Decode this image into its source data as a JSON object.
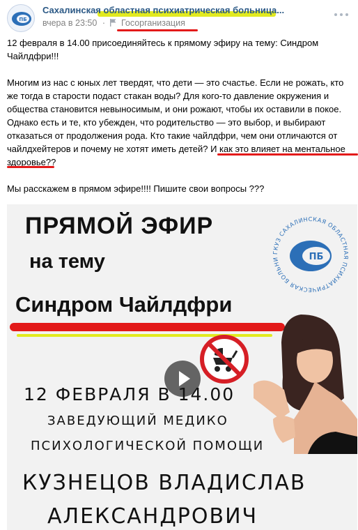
{
  "post": {
    "org_name": "Сахалинская областная психиатрическая больница",
    "org_name_display": "Сахалинская областная психиатрическая больница...",
    "time": "вчера в 23:50",
    "separator": "·",
    "category": "Госорганизация",
    "paragraphs": [
      "12 февраля в 14.00 присоединяйтесь к прямому эфиру на тему: Синдром Чайлдфри!!!",
      "Многим из нас с юных лет твердят, что дети — это счастье. Если не рожать, кто же тогда в старости подаст стакан воды? Для кого-то давление окружения и общества становится невыносимым, и они рожают, чтобы их оставили в покое. Однако есть и те, кто убежден, что родительство — это выбор, и выбирают отказаться от продолжения рода. Кто такие чайлдфри, чем они отличаются от чайлдхейтеров и почему не хотят иметь детей? И как это влияет на ментальное здоровье??",
      "Мы расскажем в прямом эфире!!!! Пишите свои вопросы ???"
    ]
  },
  "poster": {
    "title": "ПРЯМОЙ ЭФИР",
    "subtitle": "на тему",
    "theme": "Синдром Чайлдфри",
    "date_line": "12 ФЕВРАЛЯ В 14.00",
    "role_line1": "ЗАВЕДУЮЩИЙ МЕДИКО",
    "role_line2": "ПСИХОЛОГИЧЕСКОЙ ПОМОЩИ",
    "name_line1": "КУЗНЕЦОВ ВЛАДИСЛАВ",
    "name_line2": "АЛЕКСАНДРОВИЧ",
    "seal_text": "ГКУЗ САХАЛИНСКАЯ ОБЛАСТНАЯ ПСИХИАТРИЧЕСКАЯ БОЛЬНИЦА",
    "seal_initials": "ПБ"
  },
  "colors": {
    "link": "#2a5885",
    "muted": "#828282",
    "highlight_yellow": "#e2ea1f",
    "highlight_red": "#e31a1a"
  }
}
